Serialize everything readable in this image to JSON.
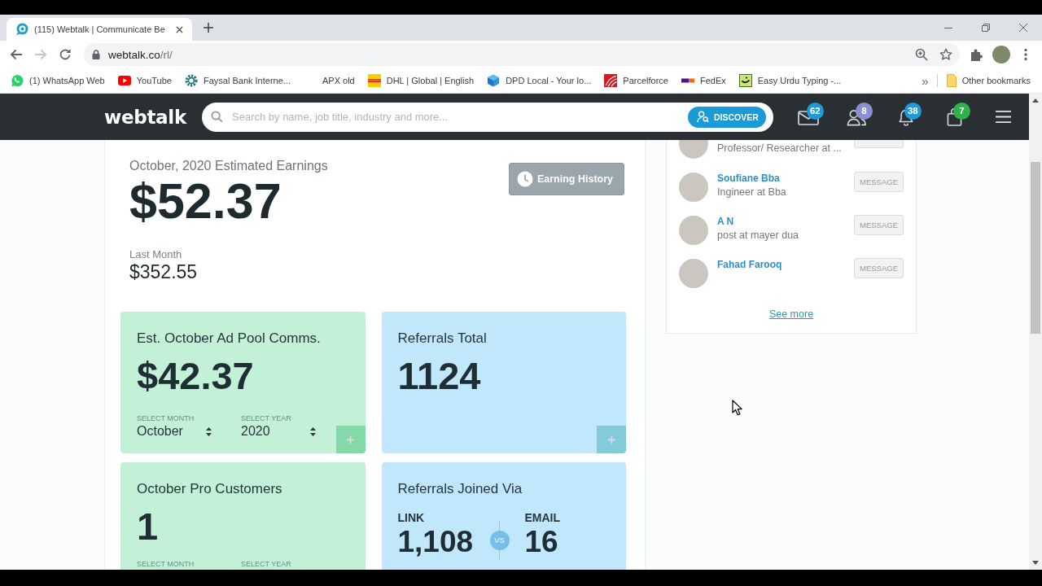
{
  "browser": {
    "tabs": [
      {
        "title": "(115) Webtalk | Communicate Be",
        "selected": true
      }
    ],
    "forward_disabled": true,
    "address": {
      "host": "webtalk.co",
      "path": "/rl/"
    },
    "bookmarks": [
      {
        "kind": "whatsapp",
        "label": "(1) WhatsApp Web"
      },
      {
        "kind": "youtube",
        "label": "YouTube"
      },
      {
        "kind": "gear",
        "label": "Faysal Bank Interne..."
      },
      {
        "kind": "blank",
        "label": "APX old"
      },
      {
        "kind": "dhl",
        "label": "DHL | Global | English"
      },
      {
        "kind": "cube",
        "label": "DPD Local - Your lo..."
      },
      {
        "kind": "parcelforce",
        "label": "Parcelforce"
      },
      {
        "kind": "fedex",
        "label": "FedEx"
      },
      {
        "kind": "urdu",
        "label": "Easy Urdu Typing -..."
      }
    ],
    "more_bookmarks": "»",
    "other_bookmarks": "Other bookmarks"
  },
  "header": {
    "logo": "webtalk",
    "search": {
      "placeholder": "Search by name, job title, industry and more..."
    },
    "discover_button": "DISCOVER",
    "icons": [
      {
        "kind": "mail",
        "badge": "62",
        "color": "#1e9bd7"
      },
      {
        "kind": "people",
        "badge": "8",
        "color": "#8a8fd4"
      },
      {
        "kind": "bell",
        "badge": "38",
        "color": "#1e9bd7"
      },
      {
        "kind": "bag",
        "badge": "7",
        "color": "#2eb24a"
      }
    ]
  },
  "earnings": {
    "title": "October, 2020 Estimated Earnings",
    "amount": "$52.37",
    "history_button": "Earning History",
    "last_month_label": "Last Month",
    "last_month_amount": "$352.55"
  },
  "cards": [
    {
      "kind": "stat",
      "color": "#c3f1d7",
      "title": "Est. October Ad Pool Comms.",
      "value": "$42.37",
      "selects": [
        {
          "label": "SELECT MONTH",
          "value": "October"
        },
        {
          "label": "SELECT YEAR",
          "value": "2020"
        }
      ],
      "add_button": true
    },
    {
      "kind": "stat",
      "color": "#c1e7fa",
      "title": "Referrals Total",
      "value": "1124",
      "add_button": true
    },
    {
      "kind": "stat",
      "color": "#c3f1d7",
      "title": "October Pro Customers",
      "value": "1",
      "selects": [
        {
          "label": "SELECT MONTH"
        },
        {
          "label": "SELECT YEAR"
        }
      ]
    },
    {
      "kind": "versus",
      "color": "#c1e7fa",
      "title": "Referrals Joined Via",
      "left": {
        "label": "LINK",
        "value": "1,108"
      },
      "vs": "VS",
      "right": {
        "label": "EMAIL",
        "value": "16"
      }
    }
  ],
  "connections": {
    "rows": [
      {
        "kind": "partial",
        "subtitle": "Professor/ Researcher at ..."
      },
      {
        "kind": "full",
        "name": "Soufiane Bba",
        "subtitle": "Ingineer at Bba",
        "button": "MESSAGE"
      },
      {
        "kind": "full",
        "name": "A N",
        "subtitle": "post at mayer dua",
        "button": "MESSAGE"
      },
      {
        "kind": "full",
        "name": "Fahad Farooq",
        "button": "MESSAGE"
      }
    ],
    "see_more": "See more"
  }
}
